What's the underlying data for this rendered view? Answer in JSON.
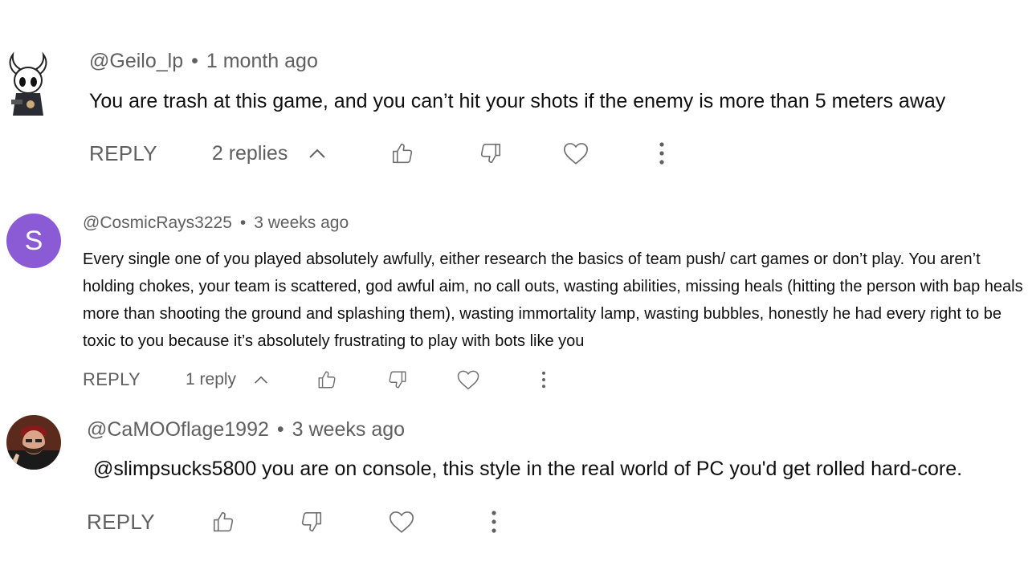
{
  "comments": [
    {
      "author": "@Geilo_lp",
      "separator": "•",
      "time": "1 month ago",
      "text": "You are trash at this game, and you can’t hit your shots if the enemy is more than 5 meters away",
      "reply_label": "REPLY",
      "replies_label": "2 replies",
      "avatar_icon": "hollow-knight-avatar-icon"
    },
    {
      "author": "@CosmicRays3225",
      "separator": "•",
      "time": "3 weeks ago",
      "avatar_letter": "S",
      "avatar_color": "#8b5bd6",
      "text": "Every single one of you played absolutely awfully, either research the basics of team push/ cart games or don’t play. You aren’t holding chokes, your team is scattered, god awful aim, no call outs, wasting abilities, missing heals (hitting the person with bap heals more than shooting the ground and splashing them), wasting immortality lamp, wasting bubbles, honestly he had every right to be toxic to you because it’s absolutely frustrating to play with bots like you",
      "reply_label": "REPLY",
      "replies_label": "1 reply"
    },
    {
      "author": "@CaMOOflage1992",
      "separator": "•",
      "time": "3 weeks ago",
      "text": "@slimpsucks5800  you are on console, this style in the real world of PC you'd get rolled hard-core.",
      "reply_label": "REPLY",
      "avatar_icon": "bearded-man-avatar-icon"
    }
  ]
}
